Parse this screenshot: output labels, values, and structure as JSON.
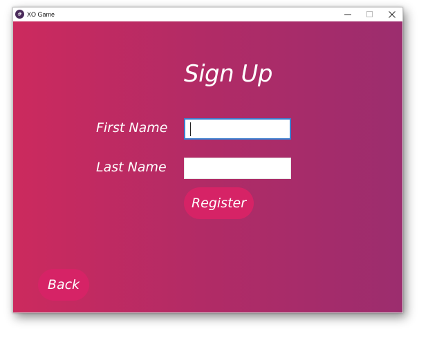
{
  "window": {
    "title": "XO Game",
    "icon": "xo-app-icon",
    "icon_glyph": "#"
  },
  "page": {
    "heading": "Sign Up"
  },
  "form": {
    "first_name_label": "First Name",
    "first_name_value": "",
    "last_name_label": "Last Name",
    "last_name_value": "",
    "register_label": "Register"
  },
  "navigation": {
    "back_label": "Back"
  },
  "colors": {
    "gradient_left": "#cc2a5e",
    "gradient_right": "#9c2d6e",
    "button": "#d62366",
    "focus_border": "#3a7fd0"
  }
}
